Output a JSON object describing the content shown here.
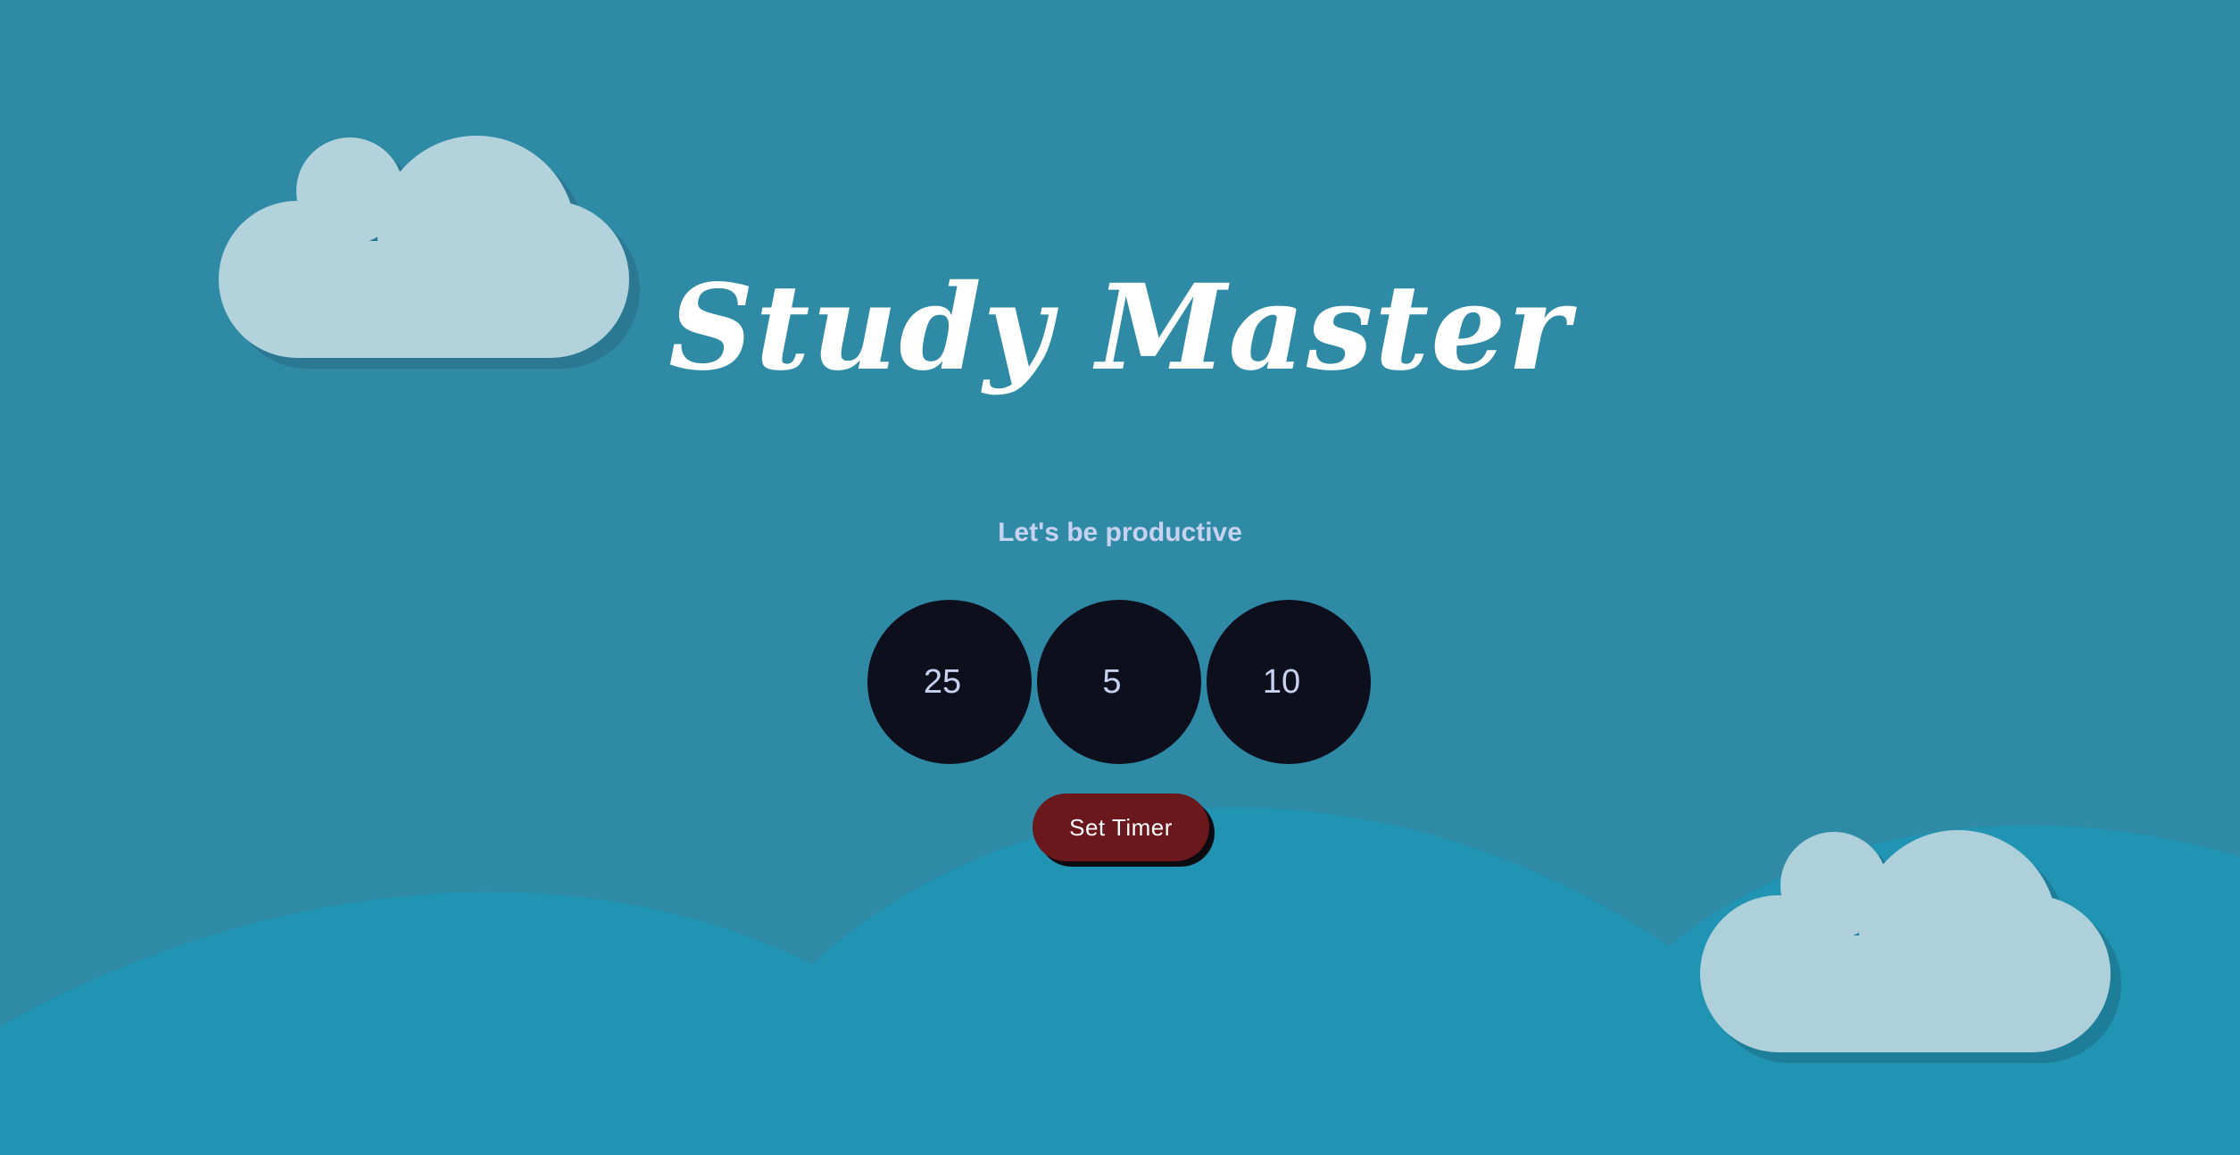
{
  "app": {
    "title": "Study Master",
    "subtitle": "Let's be productive"
  },
  "timers": [
    {
      "label": "25"
    },
    {
      "label": "5"
    },
    {
      "label": "10"
    }
  ],
  "actions": {
    "set_timer_label": "Set Timer"
  },
  "colors": {
    "sky": "#2f8aa6",
    "hills": "#2193b3",
    "cloud": "#b2d2dc",
    "timer_circle": "#0d0f1d",
    "button": "#6b181d",
    "subtitle": "#c7d2f0"
  }
}
